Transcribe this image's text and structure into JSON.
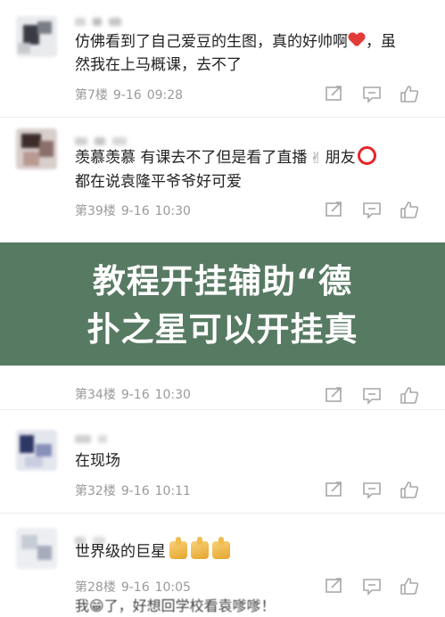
{
  "comments": [
    {
      "text_line1": "仿佛看到了自己爱豆的生图，真的好帅啊",
      "text_line1_end": "，虽",
      "text_line2": "然我在上马概课，去不了",
      "floor": "第7楼",
      "date": "9-16",
      "time": "09:28"
    },
    {
      "text_line1": "羡慕羡慕  有课去不了但是看了直播",
      "text_line1_mid": "朋友",
      "text_line2": "都在说袁隆平爷爷好可爱",
      "floor": "第39楼",
      "date": "9-16",
      "time": "10:30"
    },
    {
      "partial_text": "我😁了，好想回学校看袁嗲嗲！",
      "floor": "第34楼",
      "date": "9-16",
      "time": "10:30"
    },
    {
      "text_line1": "在现场",
      "floor": "第32楼",
      "date": "9-16",
      "time": "10:11"
    },
    {
      "text_line1": "世界级的巨星",
      "floor": "第28楼",
      "date": "9-16",
      "time": "10:05"
    }
  ],
  "banner": {
    "line1": "教程开挂辅助“德",
    "line2": "扑之星可以开挂真"
  },
  "icons": {
    "share": "share-icon",
    "comment": "comment-icon",
    "like": "like-icon"
  },
  "colors": {
    "banner_bg": "#4a7056",
    "meta_text": "#9a9a9a",
    "heart": "#e33a3a"
  }
}
